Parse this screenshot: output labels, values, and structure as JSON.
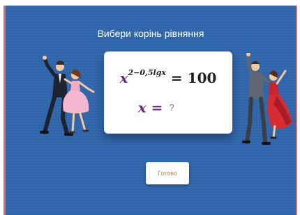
{
  "quiz": {
    "prompt": "Вибери корінь рівняння",
    "equation": {
      "variable": "x",
      "exponent": "2−0,5lgx",
      "rhs": "100"
    },
    "answer_label": "x =",
    "answer_value": "?",
    "submit_label": "Готово"
  },
  "colors": {
    "background": "#2f65aa",
    "frame_accent": "#e8696b",
    "variable": "#6b2a86",
    "button_text": "#e07a34"
  },
  "illustrations": [
    "dancing-couple-left",
    "dancing-couple-right"
  ]
}
